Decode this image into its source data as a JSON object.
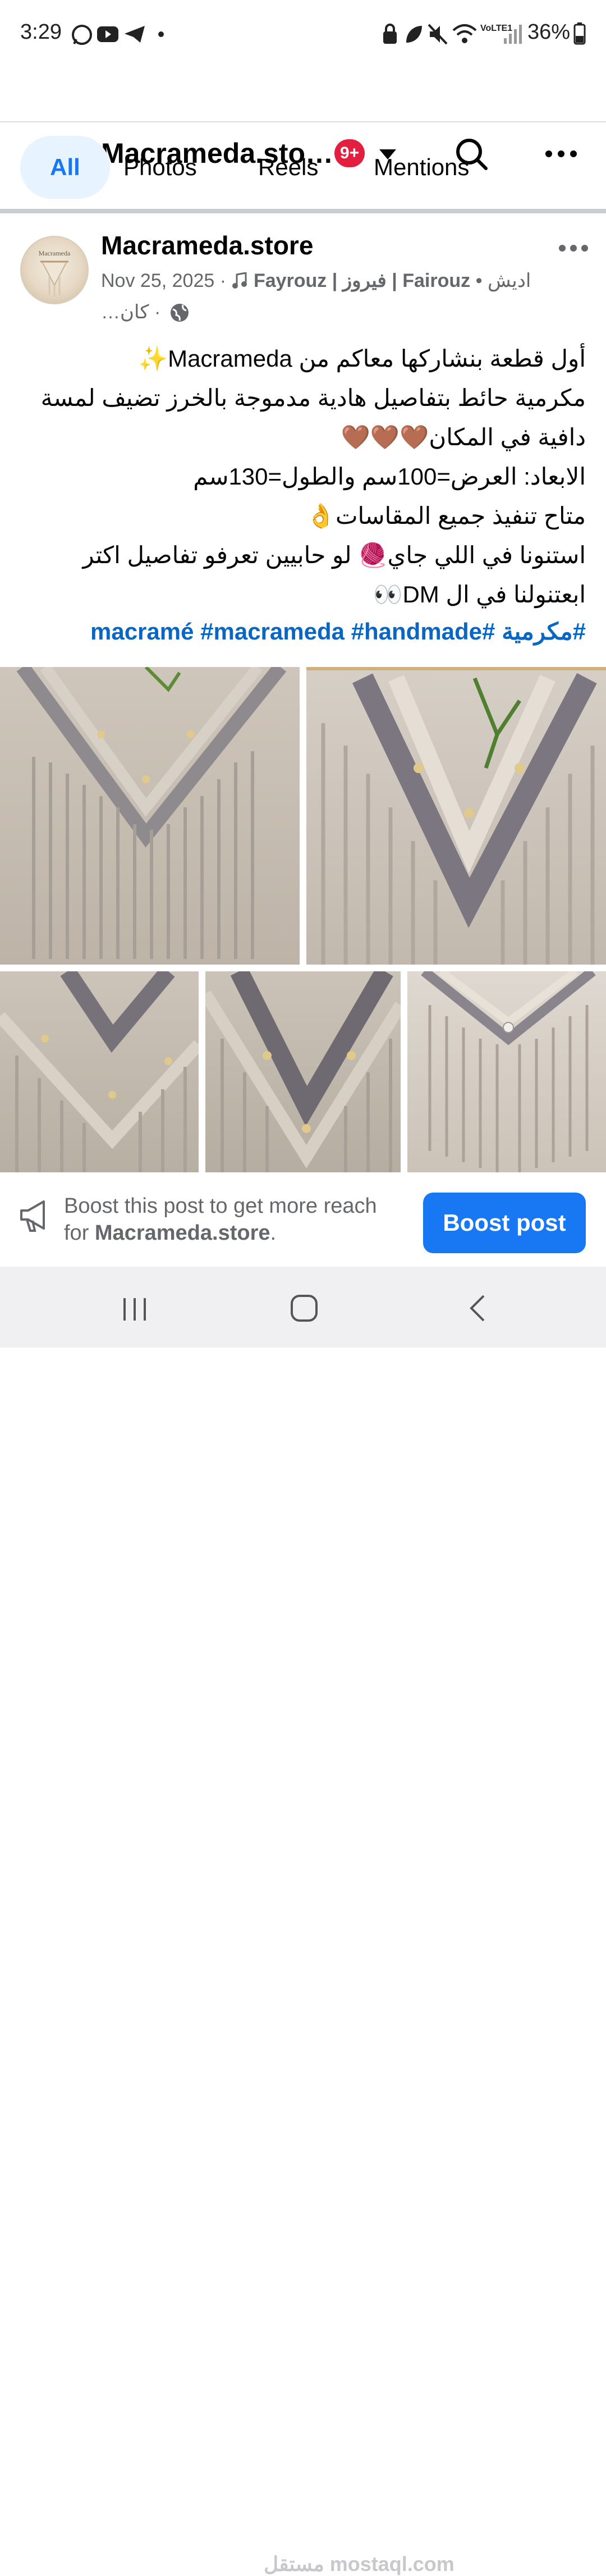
{
  "status_bar": {
    "time": "3:29",
    "battery": "36%",
    "icons": [
      "whatsapp-icon",
      "youtube-icon",
      "telegram-icon",
      "dot-icon",
      "lock-icon",
      "leaf-icon",
      "mute-icon",
      "wifi-icon",
      "volte-icon",
      "signal-icon",
      "battery-icon"
    ],
    "volte_label": "VoLTE1"
  },
  "header": {
    "title": "Macrameda.sto…",
    "badge": "9+"
  },
  "tabs": [
    {
      "label": "All"
    },
    {
      "label": "Photos"
    },
    {
      "label": "Reels"
    },
    {
      "label": "Mentions"
    }
  ],
  "post": {
    "author": "Macrameda.store",
    "avatar_text": "Macrameda",
    "meta_line1_prefix": "Nov 25, 2025 · ",
    "meta_music": "Fayrouz | فيروز | Fairouz",
    "meta_line1_suffix": " • اديش",
    "meta_line2": "…كان ·",
    "body_lines": [
      "أول قطعة بنشاركها معاكم من Macrameda✨",
      "مكرمية حائط بتفاصيل هادية مدموجة بالخرز تضيف لمسة",
      "دافية في المكان🤎🤎🤎",
      "الابعاد: العرض=100سم والطول=130سم",
      "متاح تنفيذ جميع المقاسات👌",
      "استنونا في اللي جاي🧶 لو حابيين تعرفو تفاصيل اكتر",
      "ابعتنولنا في ال DM👀"
    ],
    "hashtags": "#مكرمية #macramé #macrameda #handmade"
  },
  "boost": {
    "text_prefix": "Boost this post to get more reach",
    "text_for": "for ",
    "page_name": "Macrameda.store",
    "text_suffix": ".",
    "button": "Boost post"
  },
  "watermark": "مستقل mostaql.com",
  "colors": {
    "accent": "#1877f2",
    "badge": "#e41e3f",
    "hashtag": "#0a66c2"
  }
}
